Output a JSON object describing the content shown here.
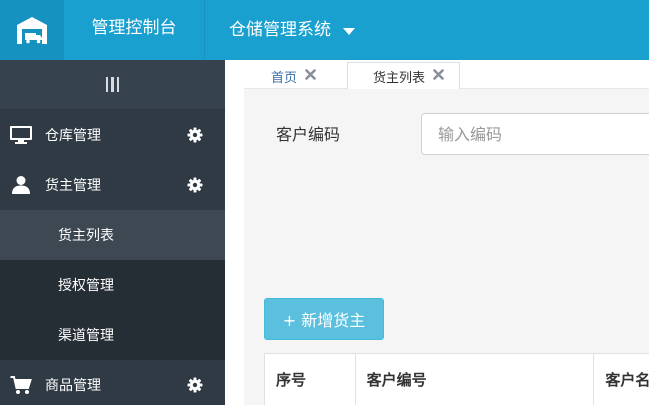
{
  "header": {
    "title": "管理控制台",
    "system": "仓储管理系统",
    "logo_icon": "warehouse-truck-icon",
    "system_dropdown_icon": "caret-down-icon"
  },
  "colors": {
    "topbar": "#1aa0cf",
    "sidebar": "#2f3a45",
    "sidebar_sub": "#252d35",
    "sidebar_active": "#3d4853",
    "accent_button": "#5bc0de"
  },
  "sidebar": {
    "toggle_icon": "menu-bars-icon",
    "items": [
      {
        "label": "仓库管理",
        "icon": "monitor-icon",
        "settings_icon": "gear-icon"
      },
      {
        "label": "货主管理",
        "icon": "user-icon",
        "settings_icon": "gear-icon"
      },
      {
        "label": "商品管理",
        "icon": "cart-icon",
        "settings_icon": "gear-icon"
      }
    ],
    "subitems": [
      {
        "label": "货主列表",
        "active": true
      },
      {
        "label": "授权管理",
        "active": false
      },
      {
        "label": "渠道管理",
        "active": false
      }
    ]
  },
  "tabs": [
    {
      "label": "首页",
      "close_icon": "close-x-icon"
    },
    {
      "label": "货主列表",
      "close_icon": "close-x-icon",
      "active": true
    }
  ],
  "search": {
    "label": "客户编码",
    "placeholder": "输入编码",
    "value": ""
  },
  "actions": {
    "add_label": "+ 新增货主"
  },
  "table": {
    "columns": [
      "序号",
      "客户编号",
      "客户名"
    ]
  }
}
